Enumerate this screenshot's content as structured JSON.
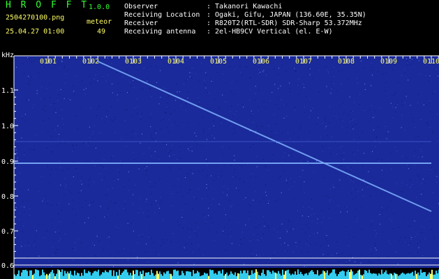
{
  "app": {
    "title": "H R O F F T",
    "version": "1.0.0"
  },
  "file": {
    "name": "2504270100.png",
    "datetime": "25.04.27 01:00"
  },
  "counter": {
    "label": "meteor",
    "value": "49"
  },
  "station": [
    {
      "label": "Observer",
      "value": ": Takanori Kawachi"
    },
    {
      "label": "Receiving Location",
      "value": ": Ogaki, Gifu, JAPAN (136.60E, 35.35N)"
    },
    {
      "label": "Receiver",
      "value": ": R820T2(RTL-SDR) SDR-Sharp 53.372MHz"
    },
    {
      "label": "Receiving antenna",
      "value": ": 2el-HB9CV Vertical (el. E-W)"
    }
  ],
  "spectrogram": {
    "y_unit": "kHz",
    "y_ticks": [
      "1.1",
      "1.0",
      "0.9",
      "0.8",
      "0.7",
      "0.6"
    ],
    "time_ticks": [
      "0101",
      "0102",
      "0103",
      "0104",
      "0105",
      "0106",
      "0107",
      "0108",
      "0109",
      "0110"
    ],
    "colors": {
      "background": "#1a2a9a",
      "signal": "#7fb0ff",
      "axis": "#ffffff",
      "tick_text": "#ffff66",
      "bottom_band": "#33ccee"
    }
  }
}
